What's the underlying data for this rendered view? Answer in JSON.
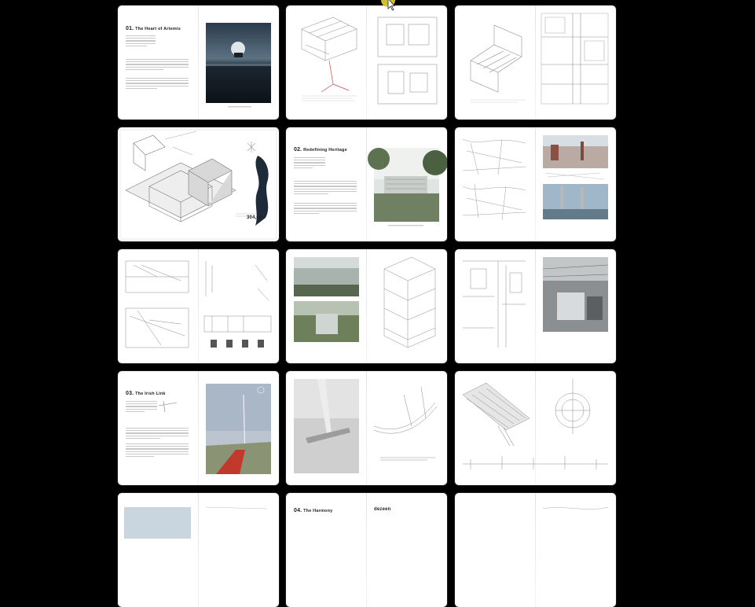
{
  "viewer": {
    "pages": [
      {
        "title_num": "01.",
        "title_text": "The Heart of Artemis"
      },
      {
        "title_num": "",
        "title_text": ""
      },
      {
        "title_num": "",
        "title_text": ""
      },
      {
        "title_num": "",
        "title_text": ""
      },
      {
        "title_num": "02.",
        "title_text": "Redefining Heritage"
      },
      {
        "title_num": "",
        "title_text": ""
      },
      {
        "title_num": "",
        "title_text": ""
      },
      {
        "title_num": "",
        "title_text": ""
      },
      {
        "title_num": "",
        "title_text": ""
      },
      {
        "title_num": "03.",
        "title_text": "The Irish Link"
      },
      {
        "title_num": "",
        "title_text": ""
      },
      {
        "title_num": "",
        "title_text": ""
      },
      {
        "title_num": "",
        "title_text": ""
      },
      {
        "title_num": "04.",
        "title_text": "The Harmony"
      },
      {
        "title_num": "",
        "title_text": ""
      }
    ],
    "diagram_label": "304,00",
    "logo_text": "dezeen",
    "accent_color": "#d9c92e",
    "cursor_icon": "pointer-arrow-icon"
  }
}
